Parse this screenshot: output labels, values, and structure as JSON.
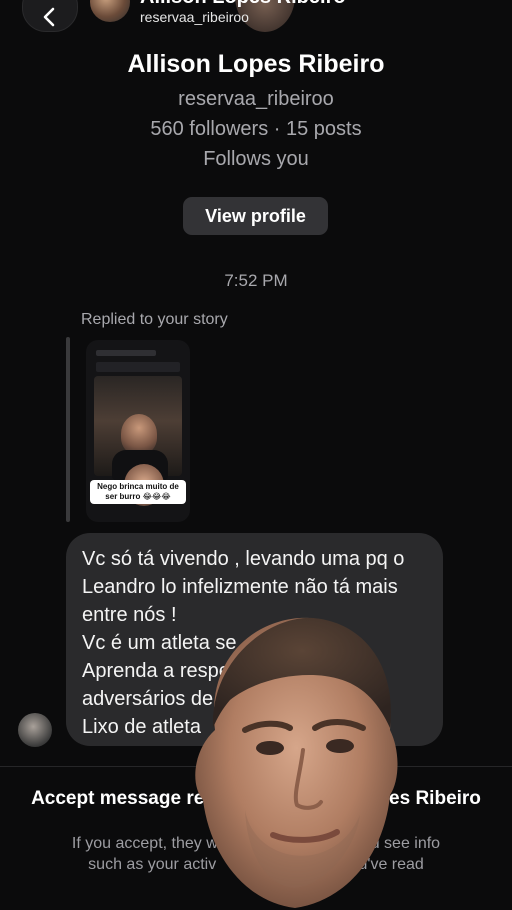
{
  "header": {
    "back_icon": "chevron-left-icon",
    "name": "Allison Lopes Ribeiro",
    "username": "reservaa_ribeiroo"
  },
  "profile": {
    "name": "Allison Lopes Ribeiro",
    "username": "reservaa_ribeiroo",
    "stats": "560 followers · 15 posts",
    "follow_status": "Follows you",
    "view_profile_label": "View profile"
  },
  "conversation": {
    "timestamp": "7:52 PM",
    "replied_label": "Replied to your story",
    "story_caption": "Nego brinca muito de ser burro 😂😂😂",
    "message_lines": [
      "Vc só tá vivendo , levando uma pq o",
      "Leandro lo infelizmente não tá mais",
      "entre nós !",
      "Vc é um atleta se",
      "Aprenda a respe",
      "adversários de                          me",
      "Lixo de atleta"
    ]
  },
  "request": {
    "title_line1": "Accept message re                                   es Ribeiro",
    "title_line2": "(rese",
    "body_line1": "If you accept, they will                              nd see info",
    "body_line2": "such as your activ                              ou've read"
  },
  "colors": {
    "background": "#0b0b0c",
    "bubble": "#2a2a2c",
    "button": "#333336",
    "secondary_text": "#a8a8ad"
  }
}
